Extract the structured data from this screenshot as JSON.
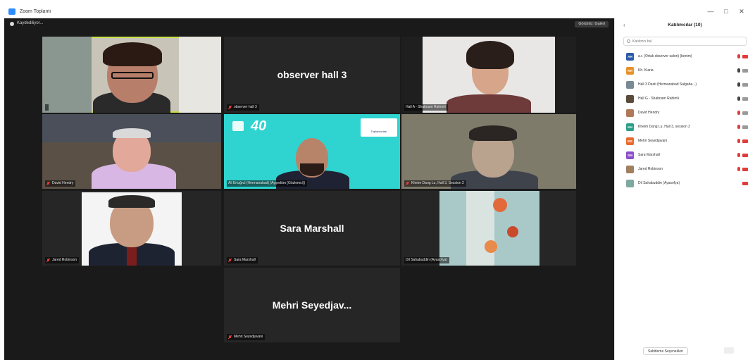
{
  "window": {
    "title": "Zoom Toplantı",
    "controls": [
      "—",
      "□",
      "✕"
    ]
  },
  "topbar": {
    "recording_label": "Kaydediliyor...",
    "view_button": "Görüntü: Galeri"
  },
  "tiles": [
    {
      "label": "",
      "big_name": ""
    },
    {
      "label": "observer hall 3",
      "big_name": "observer hall 3"
    },
    {
      "label": "Hall A - Shabnam Rahimli",
      "big_name": ""
    },
    {
      "label": "David Hendry",
      "big_name": ""
    },
    {
      "label": "Ali Ertuğrul (Hermanabad) (Ayşedüm (Gözlemci))",
      "big_name": ""
    },
    {
      "label": "Kheim Dang Lu, Hall 3, Session 2",
      "big_name": ""
    },
    {
      "label": "Jared Robinson",
      "big_name": ""
    },
    {
      "label": "Sara Marshall",
      "big_name": "Sara Marshall"
    },
    {
      "label": "Dil Sahabuddin (Ayasofya)",
      "big_name": ""
    },
    {
      "label": "Mehri Seyedjavani",
      "big_name": "Mehri  Seyedjav..."
    }
  ],
  "tile4_logo": {
    "text": "40",
    "badge": "Toplantıcıları"
  },
  "sidebar": {
    "title": "Katılımcılar (10)",
    "search_placeholder": "Katılımcı bul",
    "participants": [
      {
        "initials": "AH",
        "color": "#2d5aa8",
        "name": "a.r. (Ortak observer salon) (benim)"
      },
      {
        "initials": "KH",
        "color": "#e8912c",
        "name": "Kh. Kiaria"
      },
      {
        "initials": "",
        "color": "#7a8a95",
        "name": "Hall 3 Dasti (Hermanabad Salgaba...)"
      },
      {
        "initials": "",
        "color": "#5b4b3a",
        "name": "Hall G - Shabnam Rahimli"
      },
      {
        "initials": "",
        "color": "#b07a5a",
        "name": "David Hendry"
      },
      {
        "initials": "KH",
        "color": "#2e9e8a",
        "name": "Kheim Dang Lu, Hall 3, session 2"
      },
      {
        "initials": "MS",
        "color": "#e86a2c",
        "name": "Mehri Seyedjavani"
      },
      {
        "initials": "SM",
        "color": "#8a4fc8",
        "name": "Sara Marshall"
      },
      {
        "initials": "",
        "color": "#a08060",
        "name": "Jared Robinson"
      },
      {
        "initials": "",
        "color": "#7fa8a0",
        "name": "Dil Sahabuddin (Ayasofya)"
      }
    ],
    "footer_button": "Sabitleme Seçenekleri"
  }
}
